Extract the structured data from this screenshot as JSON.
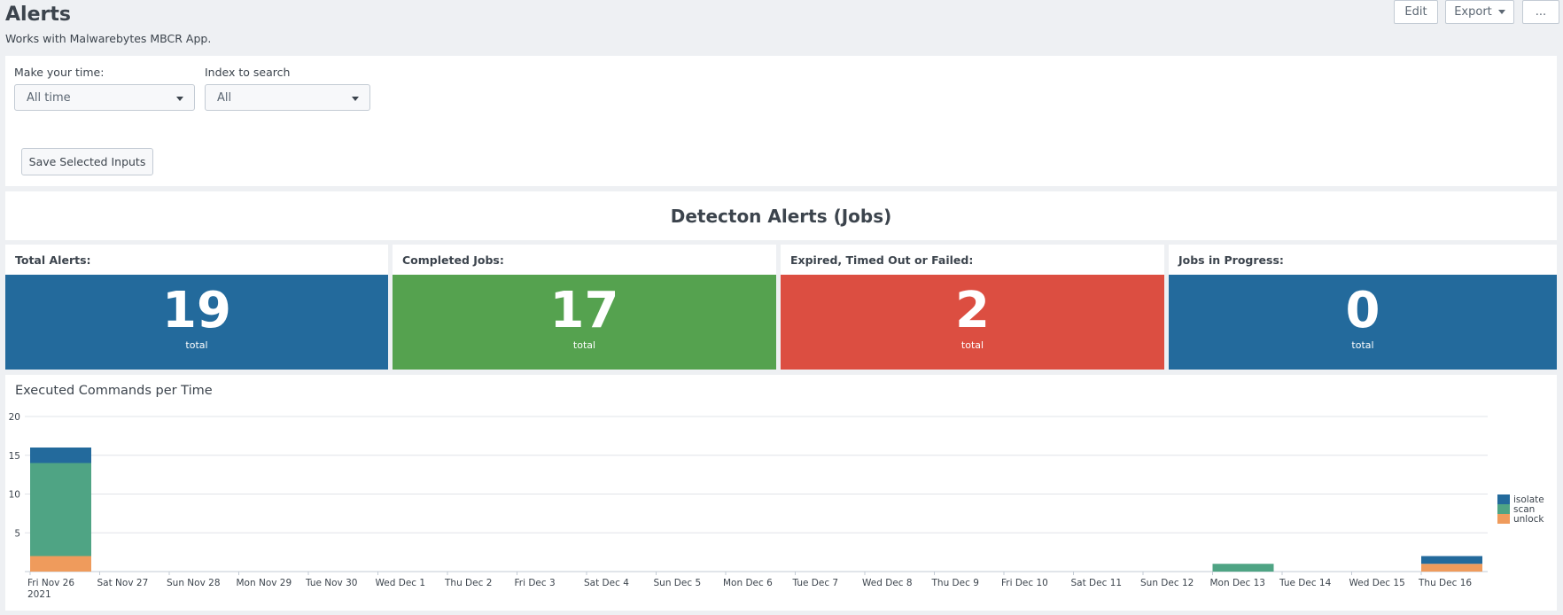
{
  "header": {
    "title": "Alerts",
    "description": "Works with Malwarebytes MBCR App.",
    "edit_label": "Edit",
    "export_label": "Export",
    "more_label": "..."
  },
  "inputs": {
    "time_label": "Make your time:",
    "time_value": "All time",
    "index_label": "Index to search",
    "index_value": "All",
    "save_label": "Save Selected Inputs"
  },
  "section_title": "Detecton Alerts (Jobs)",
  "kpis": [
    {
      "label": "Total Alerts:",
      "value": "19",
      "unit": "total",
      "color": "#236a9c"
    },
    {
      "label": "Completed Jobs:",
      "value": "17",
      "unit": "total",
      "color": "#55a24f"
    },
    {
      "label": "Expired, Timed Out or Failed:",
      "value": "2",
      "unit": "total",
      "color": "#dc4e41"
    },
    {
      "label": "Jobs in Progress:",
      "value": "0",
      "unit": "total",
      "color": "#236a9c"
    }
  ],
  "chart_title": "Executed Commands per Time",
  "chart_data": {
    "type": "bar",
    "stacked": true,
    "categories": [
      "Fri Nov 26",
      "Sat Nov 27",
      "Sun Nov 28",
      "Mon Nov 29",
      "Tue Nov 30",
      "Wed Dec 1",
      "Thu Dec 2",
      "Fri Dec 3",
      "Sat Dec 4",
      "Sun Dec 5",
      "Mon Dec 6",
      "Tue Dec 7",
      "Wed Dec 8",
      "Thu Dec 9",
      "Fri Dec 10",
      "Sat Dec 11",
      "Sun Dec 12",
      "Mon Dec 13",
      "Tue Dec 14",
      "Wed Dec 15",
      "Thu Dec 16"
    ],
    "first_category_year": "2021",
    "series": [
      {
        "name": "unlock",
        "color": "#ef9b5c",
        "values": [
          2,
          0,
          0,
          0,
          0,
          0,
          0,
          0,
          0,
          0,
          0,
          0,
          0,
          0,
          0,
          0,
          0,
          0,
          0,
          0,
          1
        ]
      },
      {
        "name": "scan",
        "color": "#4fa484",
        "values": [
          12,
          0,
          0,
          0,
          0,
          0,
          0,
          0,
          0,
          0,
          0,
          0,
          0,
          0,
          0,
          0,
          0,
          1,
          0,
          0,
          0
        ]
      },
      {
        "name": "isolate",
        "color": "#236a9c",
        "values": [
          2,
          0,
          0,
          0,
          0,
          0,
          0,
          0,
          0,
          0,
          0,
          0,
          0,
          0,
          0,
          0,
          0,
          0,
          0,
          0,
          1
        ]
      }
    ],
    "legend_order": [
      "isolate",
      "scan",
      "unlock"
    ],
    "yticks": [
      5,
      10,
      15,
      20
    ],
    "ylim": [
      0,
      20
    ],
    "grid": true,
    "legend_position": "right"
  }
}
